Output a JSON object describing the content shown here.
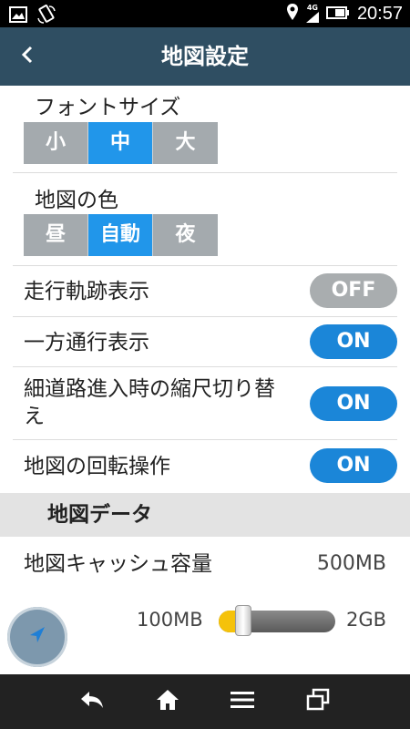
{
  "status_bar": {
    "time": "20:57",
    "network": "4G",
    "icons": [
      "image-icon",
      "rotate-icon",
      "location-icon",
      "signal-icon",
      "battery-icon"
    ]
  },
  "header": {
    "title": "地図設定",
    "back_icon": "chevron-left-icon"
  },
  "font_size": {
    "label": "フォントサイズ",
    "options": [
      "小",
      "中",
      "大"
    ],
    "selected": "中"
  },
  "map_color": {
    "label": "地図の色",
    "options": [
      "昼",
      "自動",
      "夜"
    ],
    "selected": "自動"
  },
  "toggles": [
    {
      "label": "走行軌跡表示",
      "state": "OFF"
    },
    {
      "label": "一方通行表示",
      "state": "ON"
    },
    {
      "label": "細道路進入時の縮尺切り替え",
      "label_line1": "細道路進入時の縮尺切り替",
      "label_line2": "え",
      "state": "ON"
    },
    {
      "label": "地図の回転操作",
      "state": "ON"
    }
  ],
  "map_data": {
    "section_title": "地図データ",
    "cache_label": "地図キャッシュ容量",
    "cache_value": "500MB",
    "slider_min": "100MB",
    "slider_max": "2GB",
    "slider_level": 0.21
  },
  "colors": {
    "header_bg": "#2f4e62",
    "accent": "#2196ea",
    "toggle_on": "#1b86d8",
    "toggle_off": "#a9adaf",
    "slider_fill": "#f5c20a"
  },
  "nav_bar": {
    "icons": [
      "back-arrow-icon",
      "home-icon",
      "menu-icon",
      "recent-apps-icon"
    ]
  }
}
